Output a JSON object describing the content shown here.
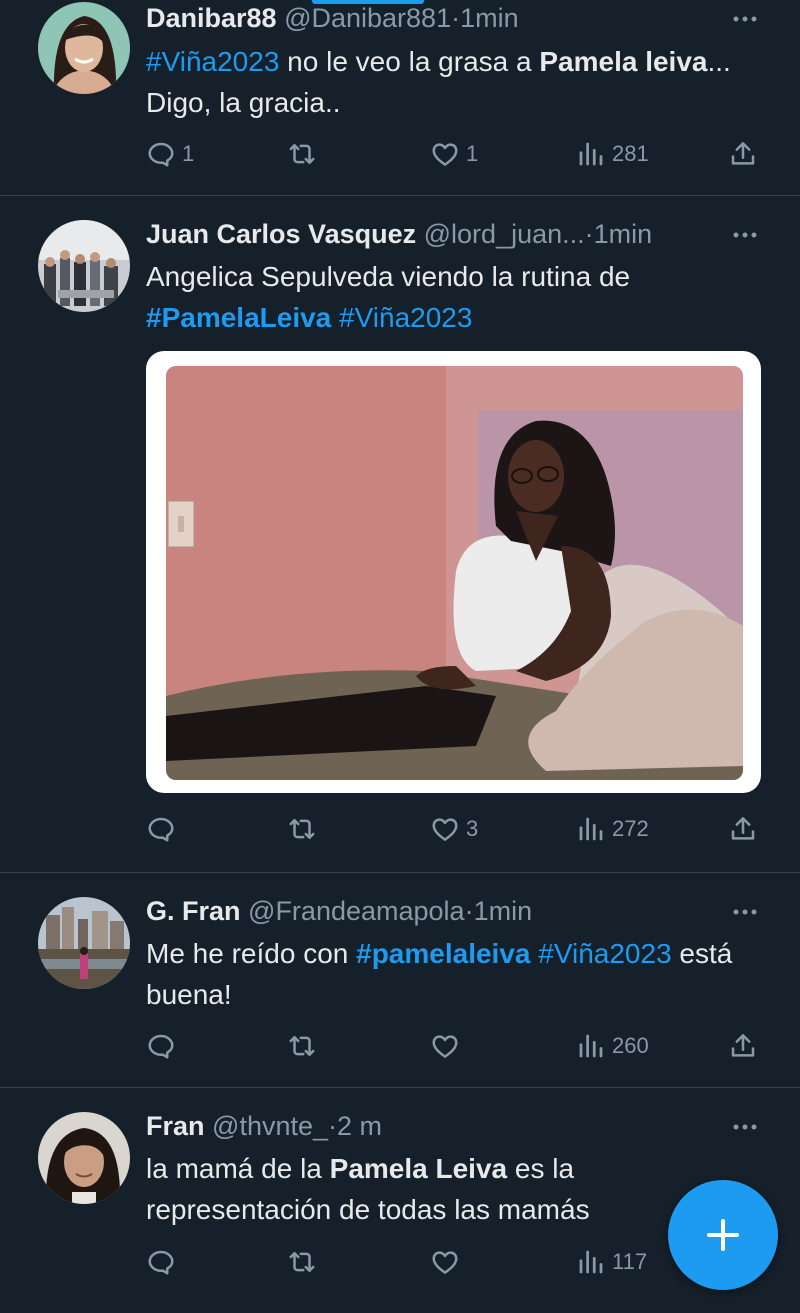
{
  "tweets": [
    {
      "name": "Danibar88",
      "handle": "@Danibar881",
      "sep": "·",
      "time": "1min",
      "text": {
        "t1": "#Viña2023",
        "t2": " no le veo la grasa a ",
        "t3": "Pamela leiva",
        "t4": "... Digo, la gracia.."
      },
      "reply_count": "1",
      "like_count": "1",
      "views": "281"
    },
    {
      "name": "Juan Carlos Vasquez",
      "handle": "@lord_juan...",
      "sep": "·",
      "time": "1min",
      "text": {
        "t1": "Angelica Sepulveda viendo la rutina de ",
        "t2": "#PamelaLeiva",
        "t3": " ",
        "t4": "#Viña2023"
      },
      "reply_count": "",
      "like_count": "3",
      "views": "272"
    },
    {
      "name": "G. Fran",
      "handle": "@Frandeamapola",
      "sep": "·",
      "time": "1min",
      "text": {
        "t1": "Me he reído con ",
        "t2": "#pamelaleiva",
        "t3": " ",
        "t4": "#Viña2023",
        "t5": " está buena!"
      },
      "reply_count": "",
      "like_count": "",
      "views": "260"
    },
    {
      "name": "Fran",
      "handle": "@thvnte_",
      "sep": "·",
      "time": "2 m",
      "text": {
        "t1": "la mamá de la ",
        "t2": "Pamela Leiva",
        "t3": " es la representación de todas las mamás"
      },
      "reply_count": "",
      "like_count": "",
      "views": "117"
    }
  ],
  "icons": [
    "reply-icon",
    "retweet-icon",
    "like-icon",
    "views-icon",
    "share-icon",
    "more-icon",
    "compose-plus-icon"
  ],
  "colors": {
    "background": "#15202b",
    "accent": "#1d9bf0",
    "muted": "#8b98a5",
    "text": "#e7e9ea",
    "divider": "#38444d"
  }
}
